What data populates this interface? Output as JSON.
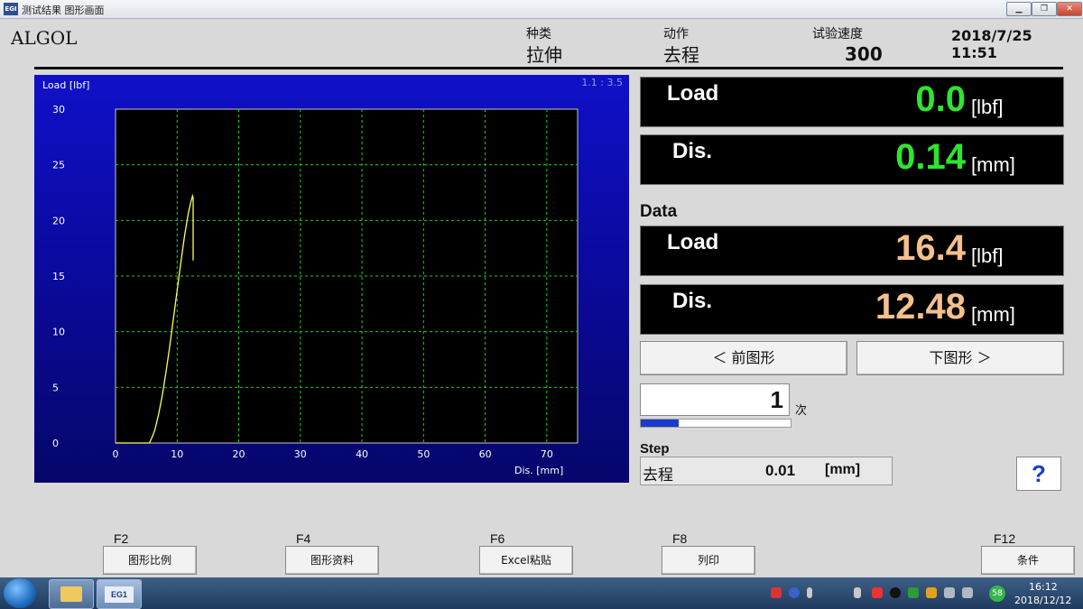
{
  "window": {
    "title": "测试结果  图形画面",
    "app_icon_text": "EGI",
    "controls": {
      "minimize": "▁",
      "restore": "❐",
      "close": "✕"
    }
  },
  "header": {
    "brand": "ALGOL",
    "type_label": "种类",
    "type_value": "拉伸",
    "action_label": "动作",
    "action_value": "去程",
    "speed_label": "试验速度",
    "speed_value": "300",
    "datetime": "2018/7/25 11:51"
  },
  "chart_data": {
    "type": "line",
    "title": "",
    "ylabel": "Load [lbf]",
    "xlabel": "Dis. [mm]",
    "ratio_label": "1.1 : 3.5",
    "xlim": [
      0,
      75
    ],
    "ylim": [
      0,
      30
    ],
    "x_ticks": [
      "0",
      "10",
      "20",
      "30",
      "40",
      "50",
      "60",
      "70"
    ],
    "y_ticks": [
      "0",
      "5",
      "10",
      "15",
      "20",
      "25",
      "30"
    ],
    "grid": true,
    "colors": {
      "line": "#ffff55",
      "grid": "#22cc22",
      "plot_bg": "#000000"
    },
    "series": [
      {
        "x": [
          0.0,
          5.5,
          6.0,
          6.4,
          7.0,
          7.6,
          8.2,
          8.8,
          9.4,
          10.0,
          10.6,
          11.2,
          11.8,
          12.2,
          12.5,
          12.6,
          12.6
        ],
        "y": [
          0.0,
          0.0,
          0.6,
          1.2,
          2.6,
          4.3,
          6.4,
          8.7,
          11.2,
          13.7,
          16.2,
          18.6,
          20.6,
          21.6,
          22.2,
          22.0,
          16.4
        ]
      }
    ]
  },
  "live": {
    "load_label": "Load",
    "load_value": "0.0",
    "load_unit": "[lbf]",
    "dis_label": "Dis.",
    "dis_value": "0.14",
    "dis_unit": "[mm]"
  },
  "data_section": {
    "heading": "Data",
    "load_label": "Load",
    "load_value": "16.4",
    "load_unit": "[lbf]",
    "dis_label": "Dis.",
    "dis_value": "12.48",
    "dis_unit": "[mm]"
  },
  "nav": {
    "prev": "＜  前图形",
    "next": "下图形  ＞"
  },
  "counter": {
    "value": "1",
    "unit": "次",
    "progress_fraction": 0.25
  },
  "step": {
    "heading": "Step",
    "name": "去程",
    "value": "0.01",
    "unit": "[mm]"
  },
  "help": {
    "label": "?"
  },
  "fkeys": [
    {
      "key": "F2",
      "label": "图形比例"
    },
    {
      "key": "F4",
      "label": "图形资料"
    },
    {
      "key": "F6",
      "label": "Excel粘贴"
    },
    {
      "key": "F8",
      "label": "列印"
    },
    {
      "key": "F12",
      "label": "条件"
    }
  ],
  "taskbar": {
    "eg1_label": "EG1",
    "tray_badge": "58",
    "time": "16:12",
    "date": "2018/12/12"
  }
}
